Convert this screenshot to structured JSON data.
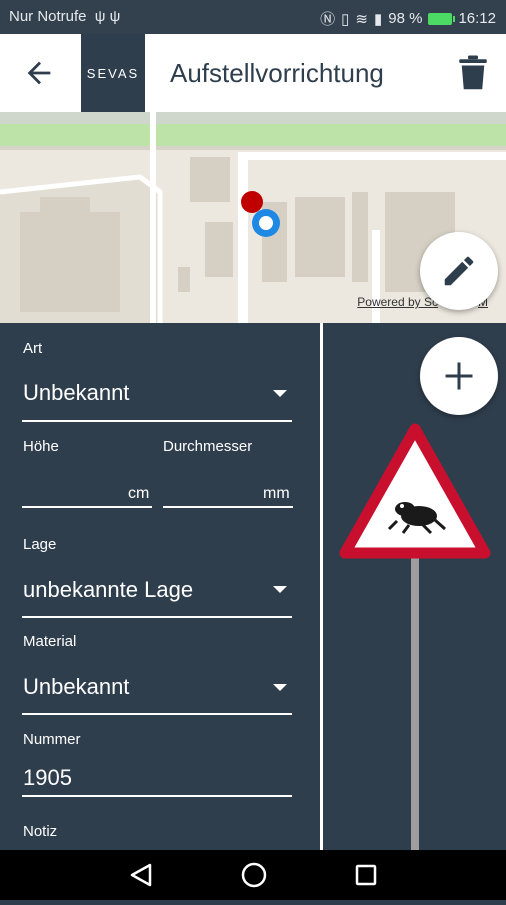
{
  "status_bar": {
    "left_text": "Nur Notrufe",
    "left_icons": [
      "usb-icon",
      "usb-icon"
    ],
    "right_icons": [
      "nfc-icon",
      "vibrate-icon",
      "wifi-icon",
      "sim-icon"
    ],
    "battery": "98 %",
    "time": "16:12"
  },
  "app_bar": {
    "back_icon": "arrow-back-icon",
    "logo_text": "SEVAS",
    "title": "Aufstellvorrichtung",
    "delete_icon": "trash-icon"
  },
  "map": {
    "attribution": "Powered by Sc",
    "attribution_tail": "M",
    "edit_icon": "pencil-icon"
  },
  "form": {
    "art": {
      "label": "Art",
      "value": "Unbekannt"
    },
    "hoehe": {
      "label": "Höhe",
      "unit": "cm"
    },
    "durchmesser": {
      "label": "Durchmesser",
      "unit": "mm"
    },
    "lage": {
      "label": "Lage",
      "value": "unbekannte Lage"
    },
    "material": {
      "label": "Material",
      "value": "Unbekannt"
    },
    "nummer": {
      "label": "Nummer",
      "value": "1905"
    },
    "notiz": {
      "label": "Notiz"
    }
  },
  "sign_panel": {
    "add_icon": "plus-icon",
    "sign_icon": "toad-crossing-warning-sign-icon"
  },
  "colors": {
    "primary": "#2f3e4d",
    "accent_red": "#c00000",
    "location_blue": "#1e88e5"
  }
}
